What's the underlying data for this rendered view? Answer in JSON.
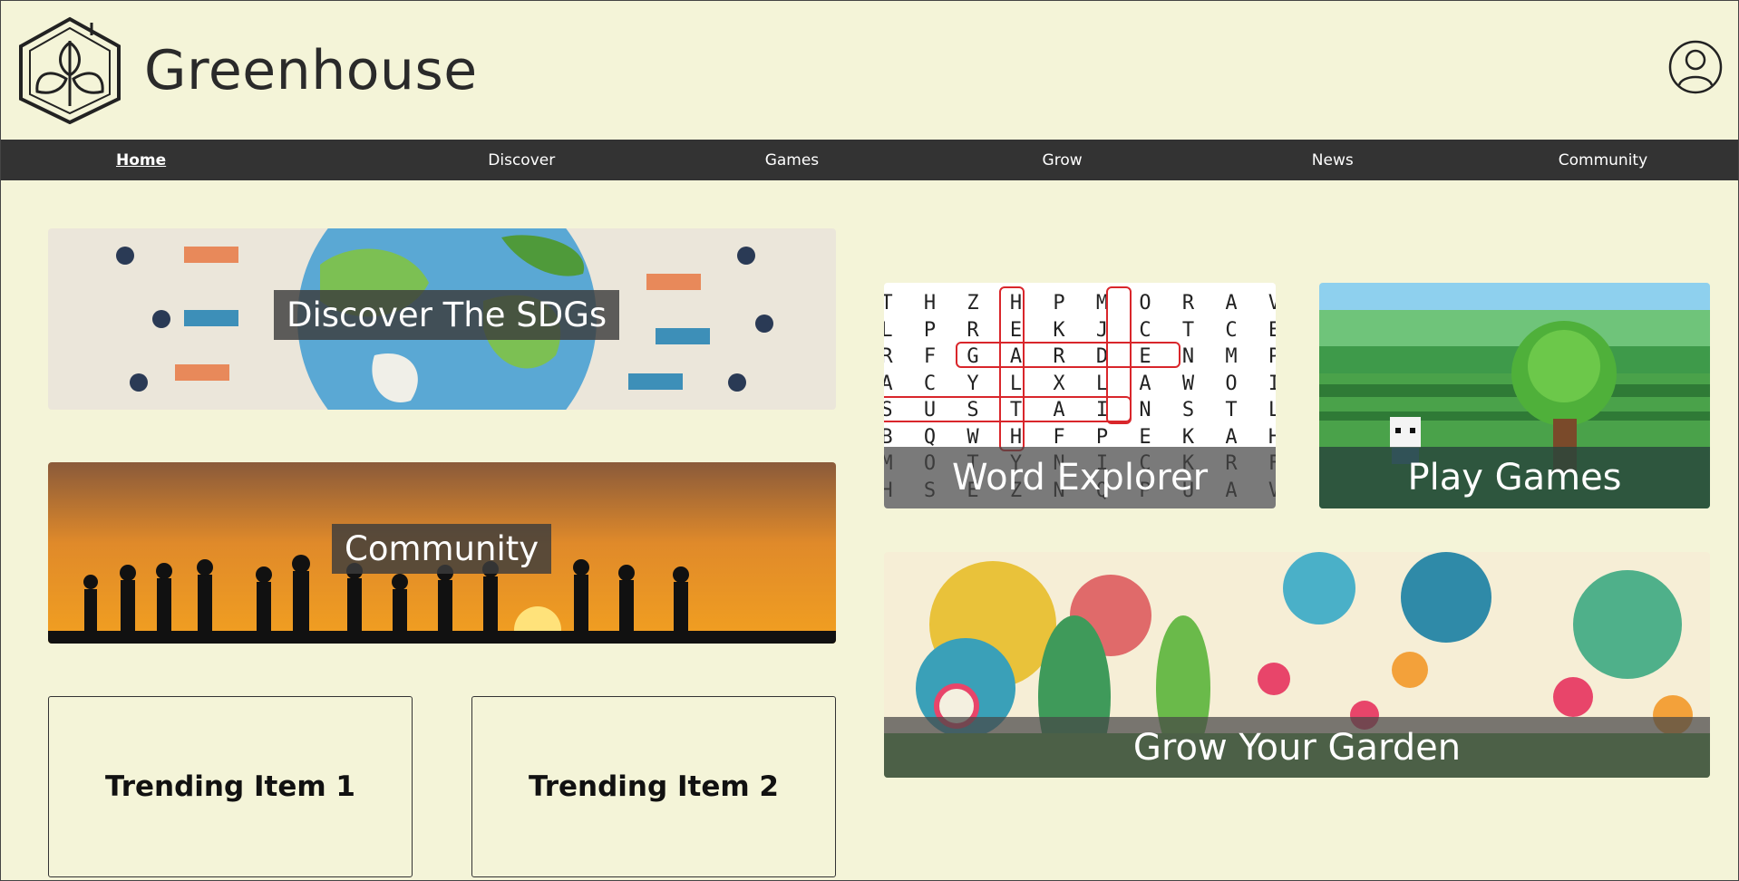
{
  "header": {
    "brand": "Greenhouse",
    "logo_icon": "greenhouse-leaf-logo-icon",
    "profile_icon": "user-avatar-icon"
  },
  "nav": {
    "items": [
      "Home",
      "Discover",
      "Games",
      "Grow",
      "News",
      "Community"
    ],
    "active": "Home"
  },
  "cards": {
    "sdgs": "Discover The SDGs",
    "community": "Community",
    "word_explorer": "Word Explorer",
    "play_games": "Play Games",
    "garden": "Grow Your Garden"
  },
  "trending": {
    "item1": "Trending Item 1",
    "item2": "Trending Item 2"
  },
  "word_grid": [
    "THZHPMORAV",
    "LPREKJCTCE",
    "RFGARDENMP",
    "ACYLXLAWOI",
    "SUSTAINSTL",
    "BQWHFPEKAH",
    "MOTYNICKRF",
    "HSEZNQPUAV"
  ],
  "colors": {
    "background": "#f4f4d8",
    "nav": "#333333",
    "highlight": "#d9262b"
  }
}
